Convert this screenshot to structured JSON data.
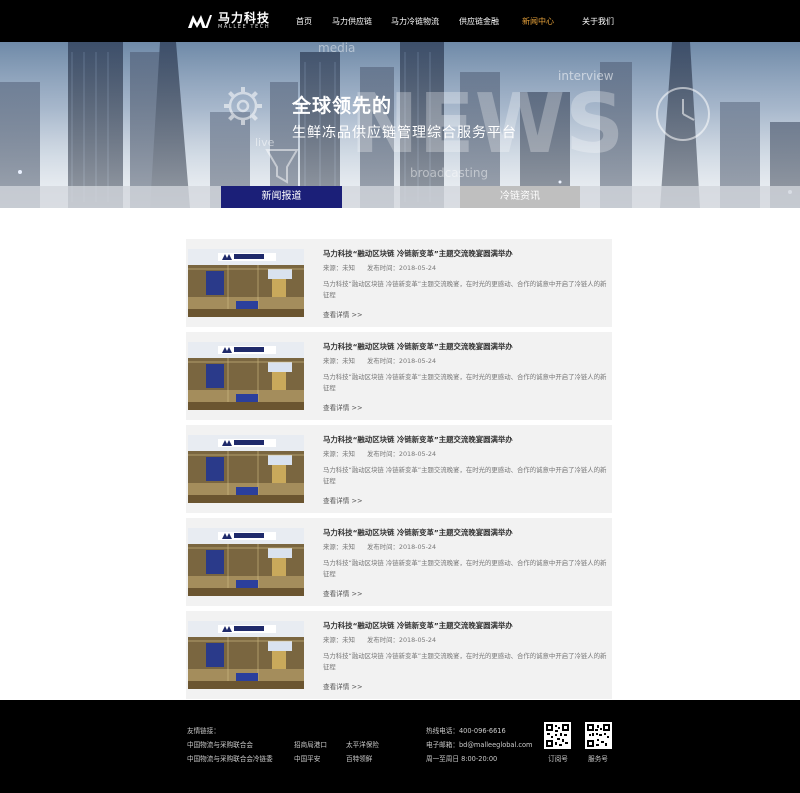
{
  "header": {
    "logo_cn": "马力科技",
    "logo_en": "MALLEE TECH",
    "nav": [
      {
        "label": "首页",
        "active": false
      },
      {
        "label": "马力供应链",
        "active": false
      },
      {
        "label": "马力冷链物流",
        "active": false
      },
      {
        "label": "供应链金融",
        "active": false
      },
      {
        "label": "新闻中心",
        "active": true
      },
      {
        "label": "关于我们",
        "active": false
      }
    ]
  },
  "banner": {
    "title": "全球领先的",
    "subtitle": "生鲜冻品供应链管理综合服务平台",
    "bg_words": [
      "media",
      "interview",
      "NEWS",
      "live",
      "broadcasting"
    ]
  },
  "tabs": [
    {
      "label": "新闻报道",
      "active": true
    },
    {
      "label": "冷链资讯",
      "active": false
    }
  ],
  "news": [
    {
      "title": "马力科技“融动区块链 冷链新变革”主题交流晚宴圆满举办",
      "source_label": "来源：",
      "source": "未知",
      "date_label": "发布时间：",
      "date": "2018-05-24",
      "summary": "马力科技“融动区块链 冷链新变革”主题交流晚宴，在时光的更感动、合作的诚意中开启了冷链人的新征程",
      "more": "查看详情 >>"
    },
    {
      "title": "马力科技“融动区块链 冷链新变革”主题交流晚宴圆满举办",
      "source_label": "来源：",
      "source": "未知",
      "date_label": "发布时间：",
      "date": "2018-05-24",
      "summary": "马力科技“融动区块链 冷链新变革”主题交流晚宴，在时光的更感动、合作的诚意中开启了冷链人的新征程",
      "more": "查看详情 >>"
    },
    {
      "title": "马力科技“融动区块链 冷链新变革”主题交流晚宴圆满举办",
      "source_label": "来源：",
      "source": "未知",
      "date_label": "发布时间：",
      "date": "2018-05-24",
      "summary": "马力科技“融动区块链 冷链新变革”主题交流晚宴，在时光的更感动、合作的诚意中开启了冷链人的新征程",
      "more": "查看详情 >>"
    },
    {
      "title": "马力科技“融动区块链 冷链新变革”主题交流晚宴圆满举办",
      "source_label": "来源：",
      "source": "未知",
      "date_label": "发布时间：",
      "date": "2018-05-24",
      "summary": "马力科技“融动区块链 冷链新变革”主题交流晚宴，在时光的更感动、合作的诚意中开启了冷链人的新征程",
      "more": "查看详情 >>"
    },
    {
      "title": "马力科技“融动区块链 冷链新变革”主题交流晚宴圆满举办",
      "source_label": "来源：",
      "source": "未知",
      "date_label": "发布时间：",
      "date": "2018-05-24",
      "summary": "马力科技“融动区块链 冷链新变革”主题交流晚宴，在时光的更感动、合作的诚意中开启了冷链人的新征程",
      "more": "查看详情 >>"
    }
  ],
  "footer": {
    "links_label": "友情链接：",
    "links": [
      "中国物流与采购联合会",
      "招商局港口",
      "太平洋保险",
      "中国物流与采购联合会冷链委",
      "中国平安",
      "百特领鲜"
    ],
    "hotline": "热线电话：400-096-6616",
    "email": "电子邮箱：bd@malleeglobal.com",
    "hours": "周一至周日 8:00-20:00",
    "qr_labels": [
      "订阅号",
      "服务号"
    ]
  },
  "colors": {
    "header_bg": "#000000",
    "nav_active": "#e6a13a",
    "tab_active": "#1b1f78",
    "tab_inactive": "#bfbfbf",
    "card_bg": "#f2f2f2",
    "footer_bg": "#000000"
  },
  "icons": [
    "logo-mark-icon",
    "gear-icon",
    "clock-icon",
    "funnel-icon",
    "qr-code-icon"
  ]
}
